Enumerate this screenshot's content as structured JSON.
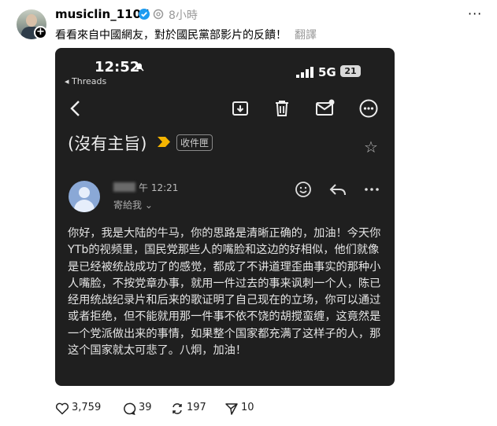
{
  "post": {
    "username": "musiclin_1107",
    "time": "8小時",
    "caption": "看看來自中國網友，對於國民黨部影片的反饋！",
    "translate_label": "翻譯",
    "more_label": "···"
  },
  "screenshot": {
    "status_time": "12:52",
    "back_app": "◂ Threads",
    "network": "5G",
    "battery": "21",
    "subject": "(沒有主旨)",
    "inbox_label": "收件匣",
    "sender_time": "午 12:21",
    "to_me": "寄給我 ⌄",
    "body": "你好，我是大陆的牛马，你的思路是清晰正确的，加油！今天你YTb的视频里，国民党那些人的嘴脸和这边的好相似，他们就像是已经被统战成功了的感觉，都成了不讲道理歪曲事实的那种小人嘴脸，不按党章办事，就用一件过去的事来讽刺一个人，陈已经用统战纪录片和后来的歌证明了自己现在的立场，你可以通过或者拒绝，但不能就用那一件事不依不饶的胡搅蛮缠，这竟然是一个党派做出来的事情，如果整个国家都充满了这样子的人，那这个国家就太可悲了。八炯，加油！"
  },
  "stats": {
    "likes": "3,759",
    "comments": "39",
    "reposts": "197",
    "shares": "10"
  }
}
